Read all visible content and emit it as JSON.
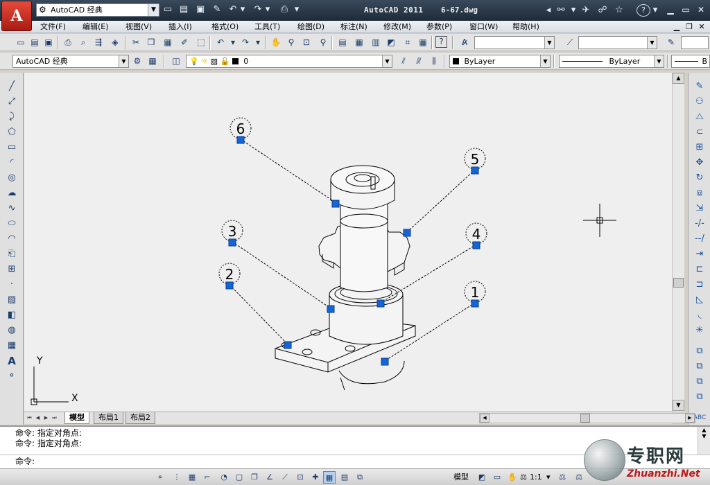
{
  "title_bar": {
    "app_name": "AutoCAD 2011",
    "file_name": "6-67.dwg",
    "workspace": "AutoCAD 经典",
    "logo_letter": "A",
    "help_icon": "?"
  },
  "menu": {
    "items": [
      "文件(F)",
      "编辑(E)",
      "视图(V)",
      "插入(I)",
      "格式(O)",
      "工具(T)",
      "绘图(D)",
      "标注(N)",
      "修改(M)",
      "参数(P)",
      "窗口(W)",
      "帮助(H)"
    ]
  },
  "toolbar2": {
    "workspace_combo": "AutoCAD 经典",
    "layer_combo": "0",
    "color_combo": "ByLayer",
    "linetype_combo": "ByLayer",
    "lineweight_combo": "B"
  },
  "drawing": {
    "balloons": [
      {
        "label": "6"
      },
      {
        "label": "5"
      },
      {
        "label": "3"
      },
      {
        "label": "4"
      },
      {
        "label": "2"
      },
      {
        "label": "1"
      }
    ],
    "ucs": {
      "x_label": "X",
      "y_label": "Y"
    }
  },
  "layout_tabs": [
    "模型",
    "布局1",
    "布局2"
  ],
  "command_line": {
    "history": [
      "命令: 指定对角点:",
      "命令: 指定对角点:"
    ],
    "prompt": "命令:"
  },
  "status_bar": {
    "model_label": "模型",
    "scale_label": "1:1"
  },
  "watermark": {
    "text_cn": "专职网",
    "text_en": "Zhuanzhi.Net"
  }
}
